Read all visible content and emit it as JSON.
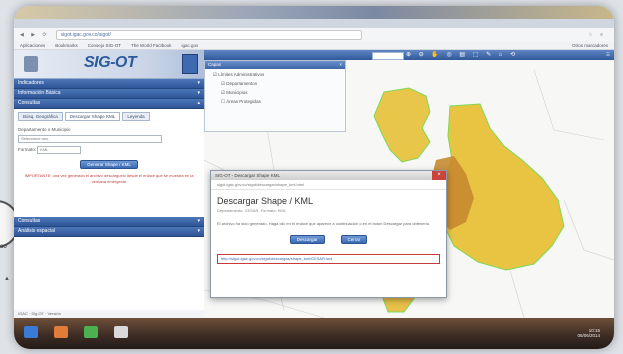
{
  "decor": {
    "circle_label": "oo"
  },
  "browser": {
    "url": "sigot.igac.gov.co/sigot/",
    "bookmarks": [
      "Aplicaciones",
      "Bookmarks",
      "Consejo SIG-OT",
      "The World Factbook",
      "igac.gov"
    ],
    "bookmarks_right": "Otros marcadores"
  },
  "sidebar": {
    "title": "SIG-OT",
    "sections_top": [
      "Indicadores",
      "Información Básica",
      "Consultas"
    ],
    "subtabs": [
      "Búsq. Geográfica",
      "Descargar Shape KML",
      "Leyenda"
    ],
    "field_label": "Departamento o Municipio",
    "select_value": "Seleccione uno",
    "format_label": "Formato:",
    "format_value": "KML",
    "action_button": "Generar Shape / KML",
    "warning": "IMPORTANTE: una vez generado el archivo descárguelo desde el enlace que se muestra en la ventana emergente",
    "sections_bottom": [
      "Consultas",
      "Análisis espacial"
    ],
    "footer": "IGAC · Sig-OT · Versión"
  },
  "map": {
    "layers_title": "Capas",
    "layers": [
      "Límites Administrativos",
      "Departamentos",
      "Municipios",
      "Áreas Protegidas"
    ]
  },
  "dialog": {
    "window_title": "SIG-OT - Descargar Shape KML",
    "url": "sigot.igac.gov.co/sigot/descargar/shape_kml.html",
    "heading": "Descargar Shape / KML",
    "subtitle": "Departamento: CESAR, Formato: KML",
    "body": "El archivo ha sido generado. Haga clic en el enlace que aparece a continuación o en el botón Descargar para obtenerlo.",
    "btn_download": "Descargar",
    "btn_close": "Cerrar",
    "link": "http://sigot.igac.gov.co/sigot/descargas/shape_kml/CESAR.kml"
  },
  "taskbar": {
    "time": "10:15",
    "date": "05/06/2014"
  }
}
